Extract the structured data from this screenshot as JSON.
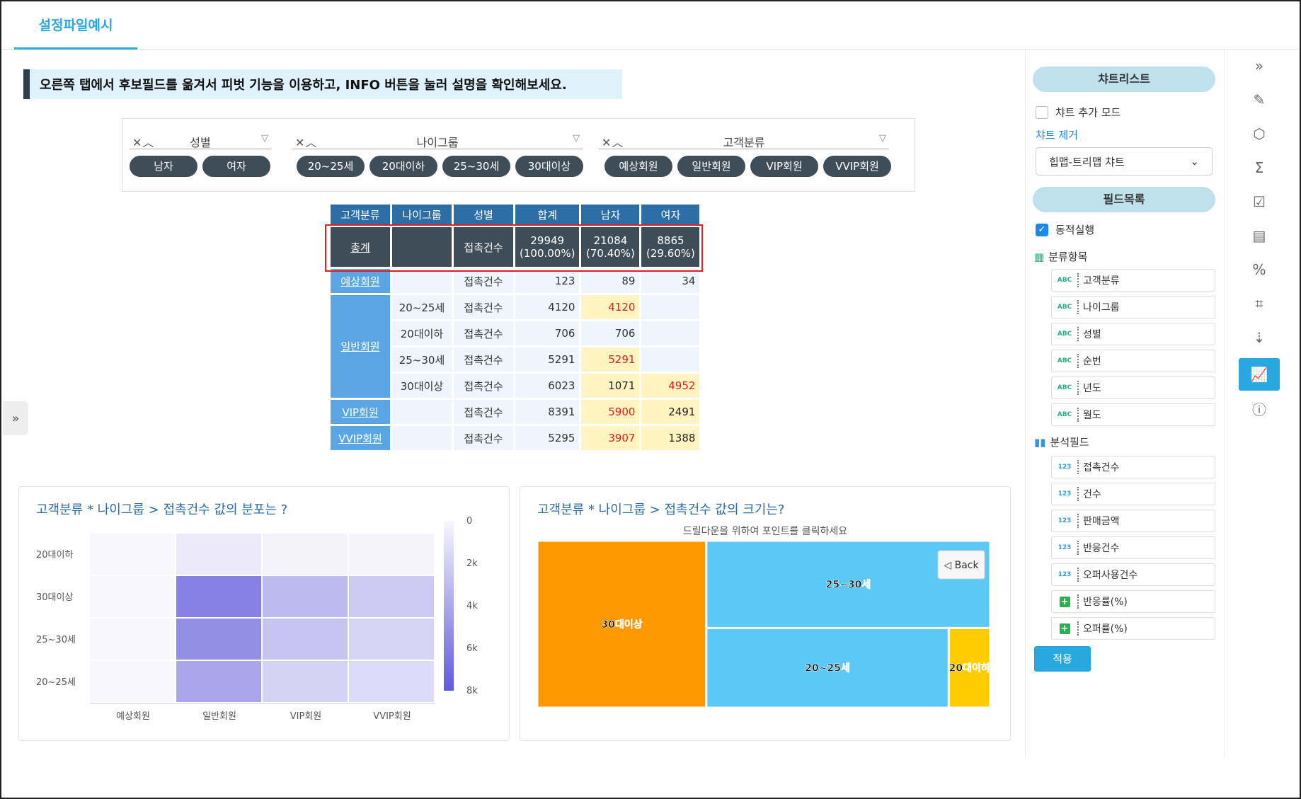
{
  "tab": {
    "title": "설정파일예시"
  },
  "notice": {
    "text": "오른쪽 탭에서 후보필드를 옮겨서 피벗 기능을 이용하고, INFO 버튼을 눌러 설명을 확인해보세요."
  },
  "filters": [
    {
      "label": "성별",
      "options": [
        "남자",
        "여자"
      ]
    },
    {
      "label": "나이그룹",
      "options": [
        "20~25세",
        "20대이하",
        "25~30세",
        "30대이상"
      ]
    },
    {
      "label": "고객분류",
      "options": [
        "예상회원",
        "일반회원",
        "VIP회원",
        "VVIP회원"
      ]
    }
  ],
  "pivot": {
    "headers": [
      "고객분류",
      "나이그룹",
      "성별",
      "합계",
      "남자",
      "여자"
    ],
    "total": {
      "label": "총계",
      "metric": "접촉건수",
      "sum": "29949",
      "sum_pct": "(100.00%)",
      "male": "21084",
      "male_pct": "(70.40%)",
      "female": "8865",
      "female_pct": "(29.60%)"
    },
    "rows": [
      {
        "cat": "예상회원",
        "age": "",
        "metric": "접촉건수",
        "sum": "123",
        "male": "89",
        "female": "34"
      },
      {
        "cat": "일반회원",
        "age": "20~25세",
        "metric": "접촉건수",
        "sum": "4120",
        "male": "4120",
        "female": ""
      },
      {
        "cat": "",
        "age": "20대이하",
        "metric": "접촉건수",
        "sum": "706",
        "male": "706",
        "female": ""
      },
      {
        "cat": "",
        "age": "25~30세",
        "metric": "접촉건수",
        "sum": "5291",
        "male": "5291",
        "female": ""
      },
      {
        "cat": "",
        "age": "30대이상",
        "metric": "접촉건수",
        "sum": "6023",
        "male": "1071",
        "female": "4952"
      },
      {
        "cat": "VIP회원",
        "age": "",
        "metric": "접촉건수",
        "sum": "8391",
        "male": "5900",
        "female": "2491"
      },
      {
        "cat": "VVIP회원",
        "age": "",
        "metric": "접촉건수",
        "sum": "5295",
        "male": "3907",
        "female": "1388"
      }
    ]
  },
  "chart_data": [
    {
      "type": "heatmap",
      "title": "고객분류 * 나이그룹 > 접촉건수 값의 분포는 ?",
      "x": [
        "예상회원",
        "일반회원",
        "VIP회원",
        "VVIP회원"
      ],
      "y": [
        "20대이하",
        "30대이상",
        "25~30세",
        "20~25세"
      ],
      "values": [
        [
          0,
          706,
          200,
          150
        ],
        [
          0,
          6023,
          3100,
          2300
        ],
        [
          0,
          5291,
          2600,
          1800
        ],
        [
          0,
          4120,
          1900,
          1500
        ]
      ],
      "colorbar_ticks": [
        "0",
        "2k",
        "4k",
        "6k",
        "8k"
      ],
      "color_range": [
        0,
        8000
      ]
    },
    {
      "type": "treemap",
      "title": "고객분류 * 나이그룹 > 접촉건수 값의 크기는?",
      "subtitle": "드릴다운을 위하여 포인트를 클릭하세요",
      "back_label": "◁ Back",
      "items": [
        {
          "name": "30대이상",
          "value": 6023,
          "color": "#ff9800"
        },
        {
          "name": "25~30세",
          "value": 5291,
          "color": "#5bc8f5"
        },
        {
          "name": "20~25세",
          "value": 4120,
          "color": "#5bc8f5"
        },
        {
          "name": "20대이하",
          "value": 706,
          "color": "#ffcc00"
        }
      ]
    }
  ],
  "sidebar": {
    "chart_list_label": "챠트리스트",
    "add_mode_label": "챠트 추가 모드",
    "remove_label": "챠트 제거",
    "chart_select": "힙맵-트리맵 챠트",
    "field_list_label": "필드목록",
    "dynamic_label": "동적실행",
    "category_label": "분류항목",
    "category_fields": [
      "고객분류",
      "나이그룹",
      "성별",
      "순번",
      "년도",
      "월도"
    ],
    "category_type": "ABC",
    "analysis_label": "분석필드",
    "analysis_fields": [
      "접촉건수",
      "건수",
      "판매금액",
      "반응건수",
      "오퍼사용건수"
    ],
    "analysis_type": "123",
    "calc_fields": [
      "반응률(%)",
      "오퍼률(%)"
    ],
    "apply_label": "적용"
  },
  "colors": {
    "accent": "#29a8e0",
    "header": "#2e6ea6",
    "dark": "#3f4d59"
  }
}
